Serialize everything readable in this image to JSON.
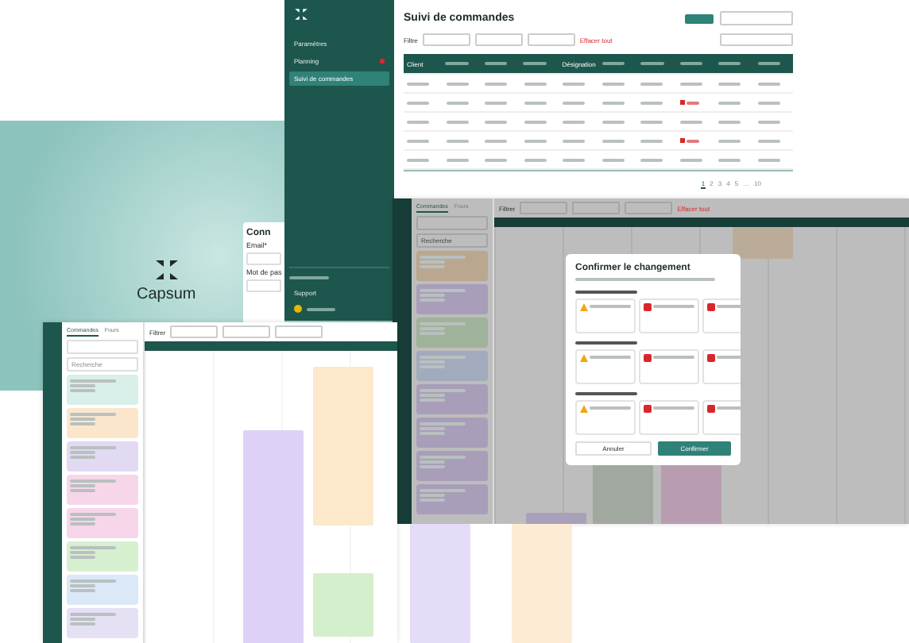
{
  "login_screen": {
    "brand": "Capsum",
    "card_title": "Conn",
    "email_label": "Email*",
    "password_label": "Mot de pas"
  },
  "sidebar": {
    "items": [
      {
        "label": "Paramètres",
        "badge": false,
        "selected": false
      },
      {
        "label": "Planning",
        "badge": true,
        "selected": false
      },
      {
        "label": "Suivi de commandes",
        "badge": false,
        "selected": true
      }
    ],
    "footer_items": [
      "Support"
    ]
  },
  "orders": {
    "title": "Suivi de commandes",
    "filter_label": "Filtre",
    "clear_label": "Effacer tout",
    "columns": [
      {
        "kind": "text",
        "label": "Client"
      },
      {
        "kind": "blurred"
      },
      {
        "kind": "blurred"
      },
      {
        "kind": "blurred"
      },
      {
        "kind": "text",
        "label": "Désignation"
      },
      {
        "kind": "blurred"
      },
      {
        "kind": "blurred"
      },
      {
        "kind": "blurred"
      },
      {
        "kind": "blurred"
      },
      {
        "kind": "blurred"
      }
    ],
    "rows": [
      {
        "blocked": false
      },
      {
        "blocked": true
      },
      {
        "blocked": false
      },
      {
        "blocked": true
      },
      {
        "blocked": false
      }
    ],
    "pages": [
      {
        "label": "1",
        "selected": true
      },
      {
        "label": "2",
        "selected": false
      },
      {
        "label": "3",
        "selected": false
      },
      {
        "label": "4",
        "selected": false
      },
      {
        "label": "5",
        "selected": false
      },
      {
        "label": "…",
        "selected": false
      },
      {
        "label": "10",
        "selected": false
      }
    ]
  },
  "planning_left": {
    "tabs": [
      {
        "label": "Commandes",
        "selected": true
      },
      {
        "label": "Fours",
        "selected": false
      }
    ],
    "search_placeholder": "Recherche",
    "filter_label": "Filtrer",
    "cards": [
      {
        "color": "#d9efe9"
      },
      {
        "color": "#fbe6cc"
      },
      {
        "color": "#e2d9f3"
      },
      {
        "color": "#f7d6ea"
      },
      {
        "color": "#f7d6ea"
      },
      {
        "color": "#d6f0cf"
      },
      {
        "color": "#dbe8f8"
      },
      {
        "color": "#e6e0f5"
      }
    ]
  },
  "planning_right": {
    "tabs": [
      {
        "label": "Commandes",
        "selected": true
      },
      {
        "label": "Fours",
        "selected": false
      }
    ],
    "search_placeholder": "Recherche",
    "filter_label": "Filtrer",
    "clear_label": "Effacer tout",
    "cards": [
      {
        "color": "#b9a78f"
      },
      {
        "color": "#a89eb9"
      },
      {
        "color": "#9fb39a"
      },
      {
        "color": "#a2abbd"
      },
      {
        "color": "#a89eb9"
      },
      {
        "color": "#a89eb9"
      },
      {
        "color": "#a89eb9"
      },
      {
        "color": "#a89eb9"
      }
    ]
  },
  "modal": {
    "title": "Confirmer le changement",
    "sections": [
      {
        "items": [
          {
            "kind": "warning"
          },
          {
            "kind": "error"
          },
          {
            "kind": "error"
          }
        ]
      },
      {
        "items": [
          {
            "kind": "warning"
          },
          {
            "kind": "error"
          },
          {
            "kind": "error"
          }
        ]
      },
      {
        "items": [
          {
            "kind": "warning"
          },
          {
            "kind": "error"
          },
          {
            "kind": "error"
          }
        ]
      }
    ],
    "cancel": "Annuler",
    "confirm": "Confirmer"
  }
}
